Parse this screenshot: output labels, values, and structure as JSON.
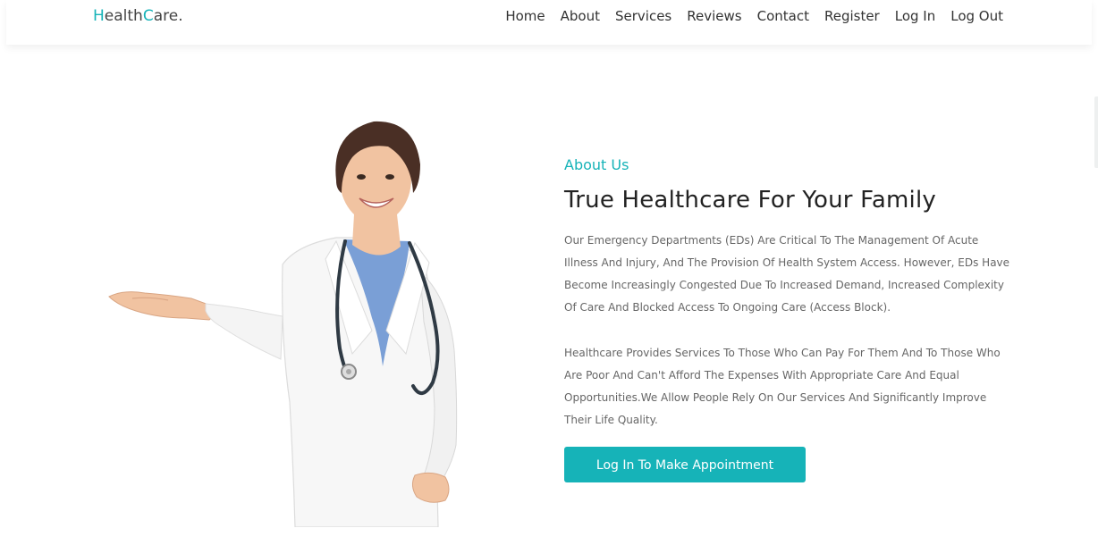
{
  "header": {
    "logo": {
      "first_initial": "H",
      "first_rest": "ealth",
      "second_initial": "C",
      "second_rest": "are."
    },
    "nav": [
      {
        "label": "Home"
      },
      {
        "label": "About"
      },
      {
        "label": "Services"
      },
      {
        "label": "Reviews"
      },
      {
        "label": "Contact"
      },
      {
        "label": "Register"
      },
      {
        "label": "Log In"
      },
      {
        "label": "Log Out"
      }
    ]
  },
  "about": {
    "kicker": "About Us",
    "title": "True Healthcare For Your Family",
    "paragraph_1": "Our Emergency Departments (EDs) Are Critical To The Management Of Acute Illness And Injury, And The Provision Of Health System Access. However, EDs Have Become Increasingly Congested Due To Increased Demand, Increased Complexity Of Care And Blocked Access To Ongoing Care (Access Block).",
    "paragraph_2": "Healthcare Provides Services To Those Who Can Pay For Them And To Those Who Are Poor And Can't Afford The Expenses With Appropriate Care And Equal Opportunities.We Allow People Rely On Our Services And Significantly Improve Their Life Quality.",
    "cta_label": "Log In To Make Appointment"
  },
  "colors": {
    "accent": "#16b3b8",
    "heading": "#222222",
    "body_text": "#666666",
    "scrub": "#7a9fd6",
    "coat": "#f7f7f7"
  },
  "icons": {
    "hero": "doctor-illustration",
    "stethoscope": "stethoscope-icon"
  }
}
